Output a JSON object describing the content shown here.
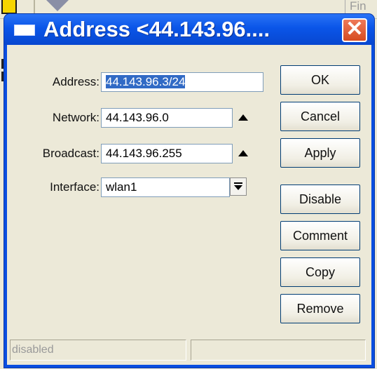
{
  "background": {
    "find_label": "Fin"
  },
  "window": {
    "title": "Address <44.143.96....",
    "close_symbol": "✕"
  },
  "form": {
    "address": {
      "label": "Address:",
      "value": "44.143.96.3/24"
    },
    "network": {
      "label": "Network:",
      "value": "44.143.96.0"
    },
    "broadcast": {
      "label": "Broadcast:",
      "value": "44.143.96.255"
    },
    "interface": {
      "label": "Interface:",
      "value": "wlan1"
    }
  },
  "buttons": {
    "ok": "OK",
    "cancel": "Cancel",
    "apply": "Apply",
    "disable": "Disable",
    "comment": "Comment",
    "copy": "Copy",
    "remove": "Remove"
  },
  "status": {
    "left": "disabled",
    "right": ""
  },
  "colors": {
    "titlebar": "#0a55e8",
    "selection": "#316ac5",
    "close": "#d64b20"
  }
}
